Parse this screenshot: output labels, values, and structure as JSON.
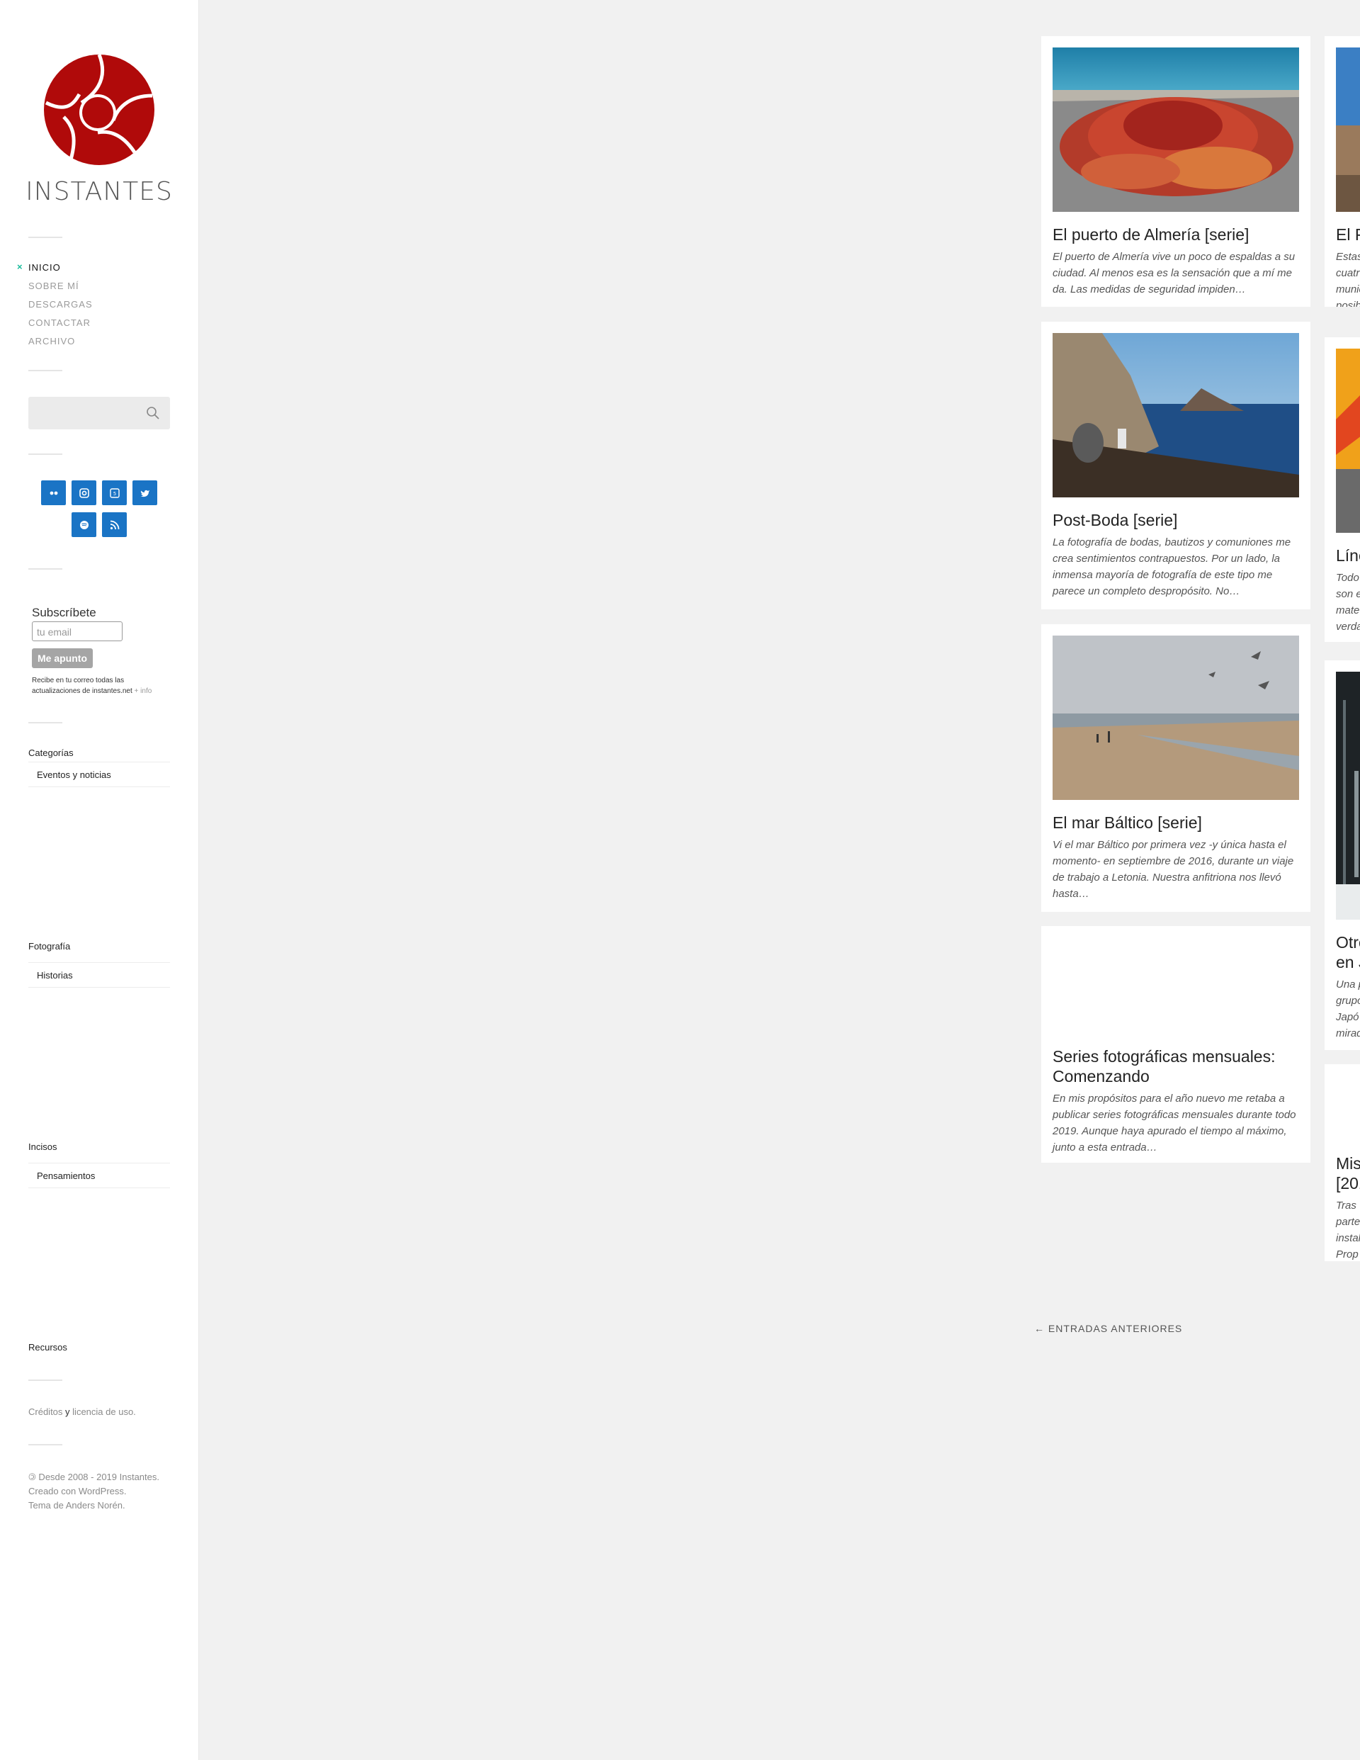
{
  "site": {
    "title": "INSTANTES"
  },
  "nav": {
    "items": [
      "INICIO",
      "SOBRE MÍ",
      "DESCARGAS",
      "CONTACTAR",
      "ARCHIVO"
    ],
    "active": "INICIO"
  },
  "search": {
    "placeholder": ""
  },
  "social": {
    "icons": [
      "flickr-icon",
      "instagram-icon",
      "500px-icon",
      "twitter-icon",
      "spotify-icon",
      "rss-icon"
    ],
    "color": "#1a74c5"
  },
  "subscribe": {
    "title": "Subscríbete",
    "email_placeholder": "tu email",
    "button": "Me apunto",
    "note": "Recibe en tu correo todas las actualizaciones de instantes.net",
    "more": "+ info"
  },
  "widgets": {
    "categorias": {
      "title": "Categorías",
      "item": "Eventos y noticias"
    },
    "fotografia": {
      "title": "Fotografía",
      "item": "Historias"
    },
    "incisos": {
      "title": "Incisos",
      "item": "Pensamientos"
    },
    "recursos": {
      "title": "Recursos"
    }
  },
  "footer": {
    "credits_a": "Créditos",
    "credits_y": "y",
    "credits_b": "licencia de uso.",
    "line1": "🄯 Desde 2008 - 2019 Instantes.",
    "line2": "Creado con WordPress.",
    "line3": "Tema de Anders Norén."
  },
  "posts_col1": [
    {
      "title": "El puerto de Almería [serie]",
      "excerpt": "El puerto de Almería vive un poco de espaldas a su ciudad. Al menos esa es la sensación que a mí me da. Las medidas de seguridad impiden…"
    },
    {
      "title": "Post-Boda [serie]",
      "excerpt": "La fotografía de bodas, bautizos y comuniones me crea sentimientos contrapuestos. Por un lado,  la inmensa mayoría de fotografía de este tipo me parece un completo despropósito. No…"
    },
    {
      "title": "El mar Báltico [serie]",
      "excerpt": "Vi el mar Báltico por primera vez -y única hasta el momento- en septiembre de 2016, durante un viaje de trabajo a Letonia. Nuestra anfitriona nos llevó hasta…"
    },
    {
      "title": "Series fotográficas mensuales: Comenzando",
      "excerpt": "En mis propósitos para el año nuevo me retaba a publicar series fotográficas mensuales durante todo 2019. Aunque haya apurado el tiempo al máximo, junto a esta entrada…"
    }
  ],
  "posts_col2": [
    {
      "title": "El P",
      "excerpt": [
        "Estas",
        "cuatr",
        "munic",
        "posib"
      ]
    },
    {
      "title": "Líne",
      "excerpt": [
        "Todo",
        "son e",
        "mate",
        "verda"
      ]
    },
    {
      "title": [
        "Otro",
        "en J"
      ],
      "excerpt": [
        "Una p",
        "grupo",
        "Japó",
        "mirad"
      ]
    },
    {
      "title": [
        "Mis",
        "[201"
      ],
      "excerpt": [
        "Tras",
        "parte",
        "instal",
        "Prop"
      ]
    }
  ],
  "pagination": {
    "older": "← ENTRADAS ANTERIORES"
  }
}
